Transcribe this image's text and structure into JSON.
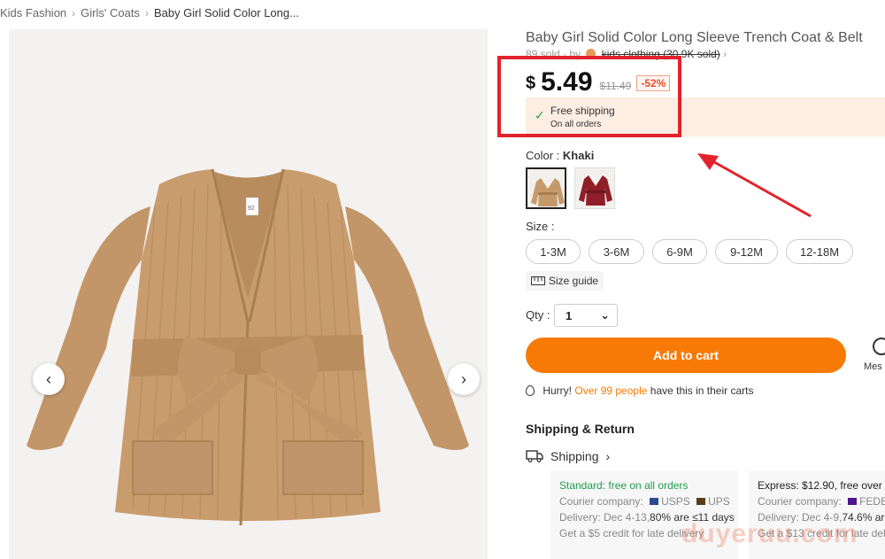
{
  "breadcrumb": {
    "items": [
      "Kids Fashion",
      "Girls' Coats",
      "Baby Girl Solid Color Long..."
    ],
    "separator": "›"
  },
  "gallery": {
    "prev_label": "‹",
    "next_label": "›",
    "garment_tag": "92"
  },
  "product": {
    "title": "Baby Girl Solid Color Long Sleeve Trench Coat & Belt",
    "sold_text": "89 sold · by",
    "store_name": "kids clothing (30.9K sold)",
    "store_chevron": "›",
    "currency": "$",
    "price": "5.49",
    "old_price": "$11.49",
    "discount": "-52%"
  },
  "shipping_banner": {
    "check": "✓",
    "title": "Free shipping",
    "subtitle": "On all orders"
  },
  "color": {
    "label": "Color : ",
    "selected": "Khaki",
    "swatches": [
      "khaki",
      "burgundy"
    ]
  },
  "size": {
    "label": "Size :",
    "options": [
      "1-3M",
      "3-6M",
      "6-9M",
      "9-12M",
      "12-18M"
    ],
    "guide_label": "Size guide"
  },
  "qty": {
    "label": "Qty :",
    "value": "1",
    "chevron": "⌄"
  },
  "actions": {
    "add_to_cart": "Add to cart",
    "message_label": "Mes"
  },
  "hurry": {
    "prefix": "Hurry!",
    "highlight": "Over 99 people",
    "suffix": "have this in their carts"
  },
  "shipping_return": {
    "title": "Shipping & Return",
    "link_label": "Shipping",
    "link_chevron": "›",
    "cards": [
      {
        "head_highlight": "Standard: free on all orders",
        "courier_label": "Courier company:",
        "couriers": [
          "USPS",
          "UPS"
        ],
        "delivery_prefix": "Delivery: Dec 4-13,",
        "delivery_suffix": "80% are ≤11 days",
        "credit": "Get a $5 credit for late delivery"
      },
      {
        "head": "Express: $12.90, free over",
        "courier_label": "Courier company:",
        "couriers": [
          "FEDE"
        ],
        "delivery_prefix": "Delivery: Dec 4-9,",
        "delivery_suffix": "74.6% are",
        "credit": "Get a $13 credit for late deli"
      }
    ]
  },
  "watermark": "duyeruu.com",
  "colors": {
    "accent": "#f77a07",
    "highlight_red": "#e2232b",
    "green": "#1e9c4b",
    "banner": "#fdeee3",
    "coat": "#c59a6b"
  }
}
